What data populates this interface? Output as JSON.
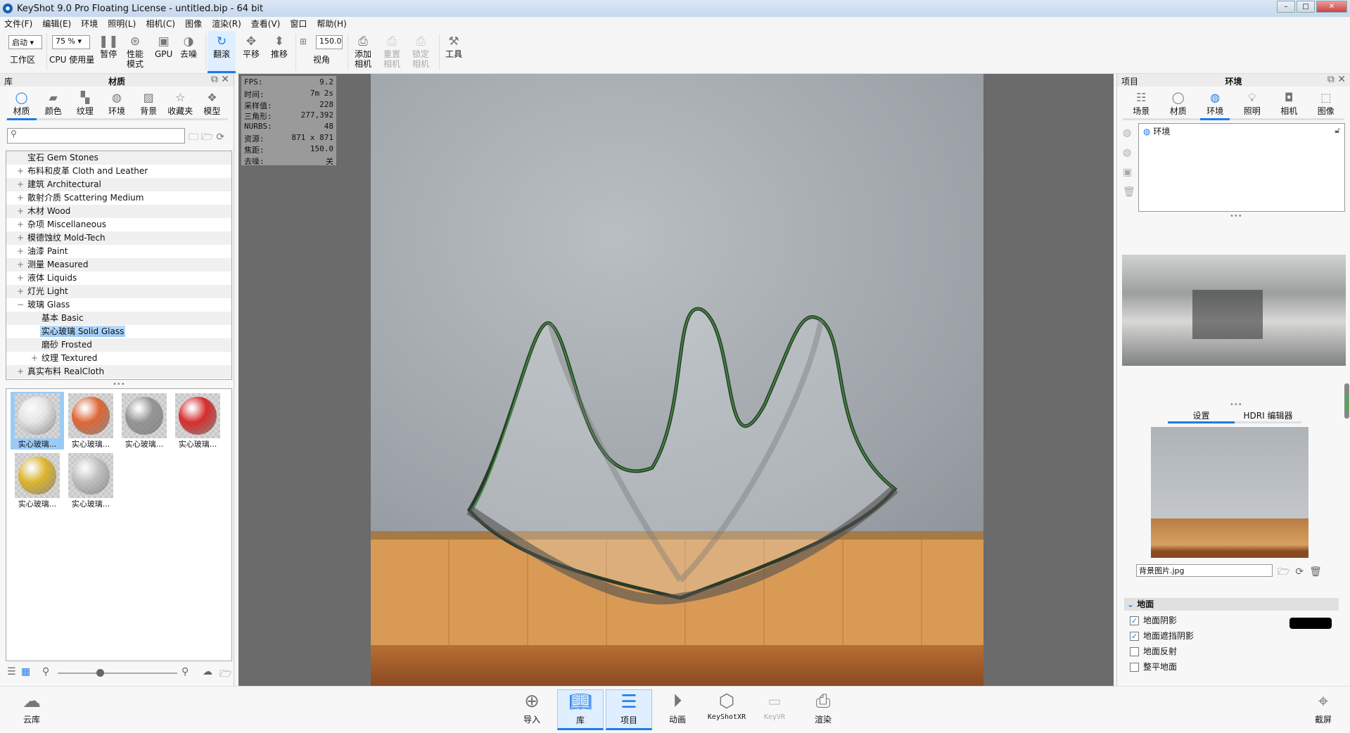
{
  "window": {
    "title": "KeyShot 9.0 Pro Floating License  - untitled.bip  - 64 bit"
  },
  "menu": [
    "文件(F)",
    "编辑(E)",
    "环境",
    "照明(L)",
    "相机(C)",
    "图像",
    "渲染(R)",
    "查看(V)",
    "窗口",
    "帮助(H)"
  ],
  "toolbar": {
    "workspace_value": "启动",
    "workspace_label": "工作区",
    "cpu_value": "75 %",
    "cpu_label": "CPU 使用量",
    "pause": "暂停",
    "perf_mode": "性能\n模式",
    "gpu": "GPU",
    "denoise": "去噪",
    "tumble": "翻滚",
    "pan": "平移",
    "dolly": "推移",
    "fov_value": "150.0",
    "fov_label": "视角",
    "add_camera": "添加\n相机",
    "reset_camera": "重置\n相机",
    "lock_camera": "锁定\n相机",
    "tools": "工具"
  },
  "library": {
    "title_left": "库",
    "title": "材质",
    "tabs": [
      "材质",
      "颜色",
      "纹理",
      "环境",
      "背景",
      "收藏夹",
      "模型"
    ],
    "active_tab": 0,
    "search_placeholder": "",
    "tree": [
      {
        "label": "宝石 Gem Stones",
        "level": 0,
        "exp": ""
      },
      {
        "label": "布料和皮革 Cloth and Leather",
        "level": 0,
        "exp": "+"
      },
      {
        "label": "建筑 Architectural",
        "level": 0,
        "exp": "+"
      },
      {
        "label": "散射介质 Scattering Medium",
        "level": 0,
        "exp": "+"
      },
      {
        "label": "木材 Wood",
        "level": 0,
        "exp": "+"
      },
      {
        "label": "杂项 Miscellaneous",
        "level": 0,
        "exp": "+"
      },
      {
        "label": "模德蚀纹 Mold-Tech",
        "level": 0,
        "exp": "+"
      },
      {
        "label": "油漆 Paint",
        "level": 0,
        "exp": "+"
      },
      {
        "label": "测量 Measured",
        "level": 0,
        "exp": "+"
      },
      {
        "label": "液体 Liquids",
        "level": 0,
        "exp": "+"
      },
      {
        "label": "灯光 Light",
        "level": 0,
        "exp": "+"
      },
      {
        "label": "玻璃 Glass",
        "level": 0,
        "exp": "−"
      },
      {
        "label": "基本 Basic",
        "level": 1,
        "exp": ""
      },
      {
        "label": "实心玻璃 Solid Glass",
        "level": 1,
        "exp": "",
        "selected": true
      },
      {
        "label": "磨砂 Frosted",
        "level": 1,
        "exp": ""
      },
      {
        "label": "纹理 Textured",
        "level": 1,
        "exp": "+"
      },
      {
        "label": "真实布料 RealCloth",
        "level": 0,
        "exp": "+"
      }
    ],
    "thumbnails": [
      {
        "label": "实心玻璃...",
        "color": "#e8e8e8",
        "selected": true
      },
      {
        "label": "实心玻璃...",
        "color": "#e2541a"
      },
      {
        "label": "实心玻璃...",
        "color": "#8a8a8a"
      },
      {
        "label": "实心玻璃...",
        "color": "#d81010"
      },
      {
        "label": "实心玻璃...",
        "color": "#e0b010"
      },
      {
        "label": "实心玻璃...",
        "color": "#bdbdbd"
      }
    ],
    "zoom_slider": 0.35
  },
  "hud": [
    {
      "k": "FPS:",
      "v": "9.2"
    },
    {
      "k": "时间:",
      "v": "7m 2s"
    },
    {
      "k": "采样值:",
      "v": "228"
    },
    {
      "k": "三角形:",
      "v": "277,392"
    },
    {
      "k": "NURBS:",
      "v": "48"
    },
    {
      "k": "资源:",
      "v": "871 x 871"
    },
    {
      "k": "焦距:",
      "v": "150.0"
    },
    {
      "k": "去噪:",
      "v": "关"
    }
  ],
  "project": {
    "title_left": "项目",
    "title": "环境",
    "tabs": [
      "场景",
      "材质",
      "环境",
      "照明",
      "相机",
      "图像"
    ],
    "active_tab": 2,
    "env_item": "环境",
    "subtabs": [
      "设置",
      "HDRI 编辑器"
    ],
    "bg_file": "背景图片.jpg",
    "ground_section": "地面",
    "ground": [
      {
        "label": "地面阴影",
        "checked": true
      },
      {
        "label": "地面遮挡阴影",
        "checked": true
      },
      {
        "label": "地面反射",
        "checked": false
      },
      {
        "label": "整平地面",
        "checked": false
      }
    ],
    "shadow_color": "#000000"
  },
  "bottom": {
    "cloud": "云库",
    "import": "导入",
    "library": "库",
    "project": "项目",
    "animation": "动画",
    "keyshotxr": "KeyShotXR",
    "keyvr": "KeyVR",
    "render": "渲染",
    "screenshot": "截屏"
  },
  "colors": {
    "accent": "#1e7be6",
    "selection": "#9acbf6"
  }
}
